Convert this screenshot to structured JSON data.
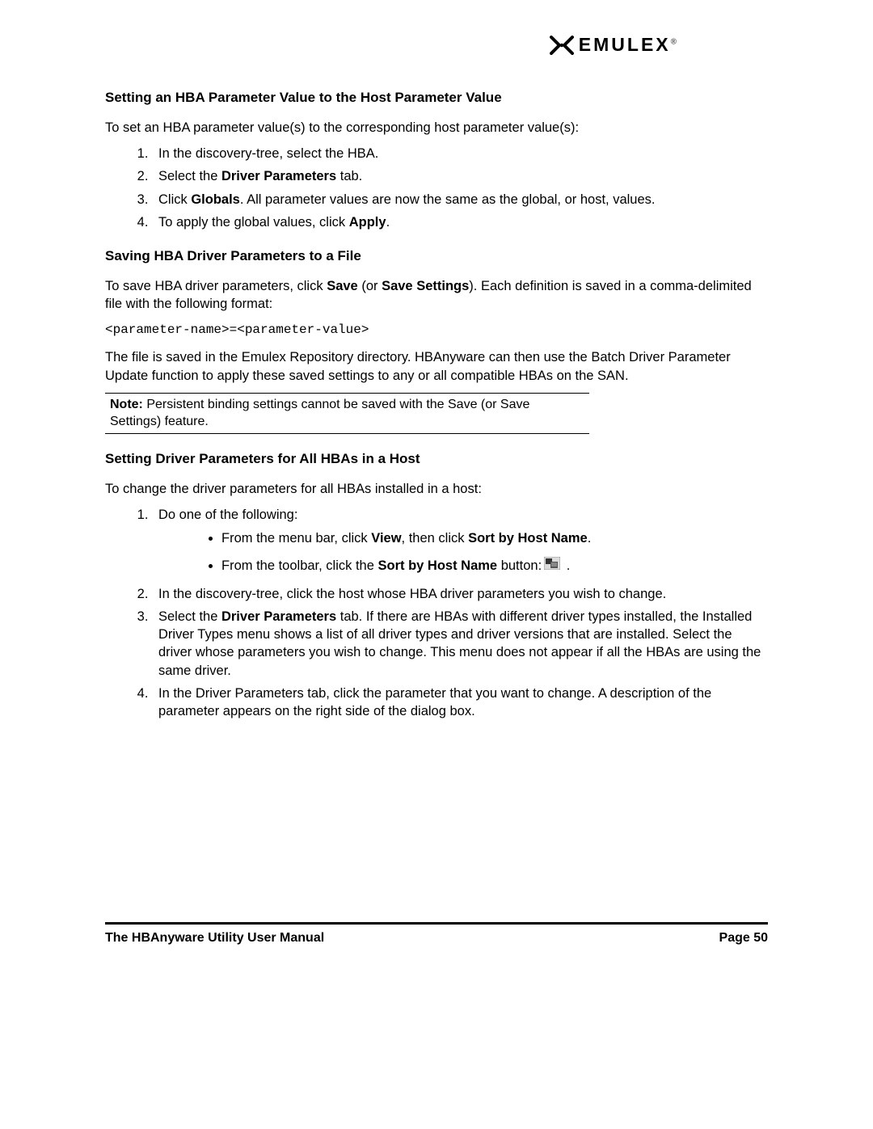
{
  "logo": {
    "text": "EMULEX",
    "reg": "®"
  },
  "s1": {
    "heading": "Setting an HBA Parameter Value to the Host Parameter Value",
    "intro": "To set an HBA parameter value(s) to the corresponding host parameter value(s):",
    "li1": "In the discovery-tree, select the HBA.",
    "li2_a": "Select the ",
    "li2_b": "Driver Parameters",
    "li2_c": " tab.",
    "li3_a": "Click ",
    "li3_b": "Globals",
    "li3_c": ". All parameter values are now the same as the global, or host, values.",
    "li4_a": "To apply the global values, click ",
    "li4_b": "Apply",
    "li4_c": "."
  },
  "s2": {
    "heading": "Saving HBA Driver Parameters to a File",
    "p1_a": "To save HBA driver parameters, click ",
    "p1_b": "Save",
    "p1_c": " (or ",
    "p1_d": "Save Settings",
    "p1_e": "). Each definition is saved in a comma-delimited file with the following format:",
    "code": "<parameter-name>=<parameter-value>",
    "p2": "The file is saved in the Emulex Repository directory. HBAnyware can then use the Batch Driver Parameter Update function to apply these saved settings to any or all compatible HBAs on the SAN.",
    "note_label": "Note:",
    "note_text": " Persistent binding settings cannot be saved with the Save (or Save Settings) feature."
  },
  "s3": {
    "heading": "Setting Driver Parameters for All HBAs in a Host",
    "intro": "To change the driver parameters for all HBAs installed in a host:",
    "li1": "Do one of the following:",
    "b1_a": "From the menu bar, click ",
    "b1_b": "View",
    "b1_c": ", then click ",
    "b1_d": "Sort by Host Name",
    "b1_e": ".",
    "b2_a": "From the toolbar, click the ",
    "b2_b": "Sort by Host Name",
    "b2_c": " button:",
    "b2_d": " .",
    "li2": "In the discovery-tree, click the host whose HBA driver parameters you wish to change.",
    "li3_a": "Select the ",
    "li3_b": "Driver Parameters",
    "li3_c": " tab. If there are HBAs with different driver types installed, the Installed Driver Types menu shows a list of all driver types and driver versions that are installed. Select the driver whose parameters you wish to change. This menu does not appear if all the HBAs are using the same driver.",
    "li4": "In the Driver Parameters tab, click the parameter that you want to change. A description of the parameter appears on the right side of the dialog box."
  },
  "footer": {
    "left": "The HBAnyware Utility User Manual",
    "right": "Page 50"
  }
}
